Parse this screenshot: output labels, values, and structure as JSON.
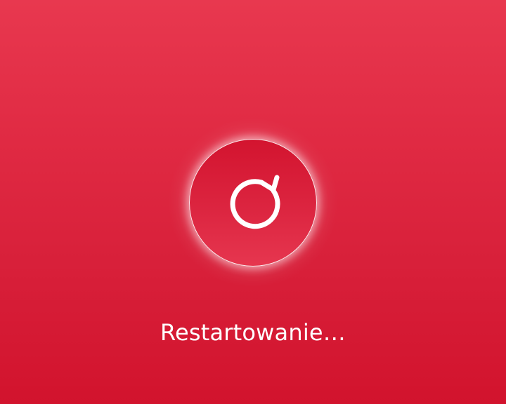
{
  "status": {
    "text": "Restartowanie…"
  },
  "icon": {
    "name": "restart-icon"
  },
  "colors": {
    "background_top": "#e8384f",
    "background_bottom": "#d2132d",
    "circle_fill": "#d8203a",
    "foreground": "#ffffff"
  }
}
